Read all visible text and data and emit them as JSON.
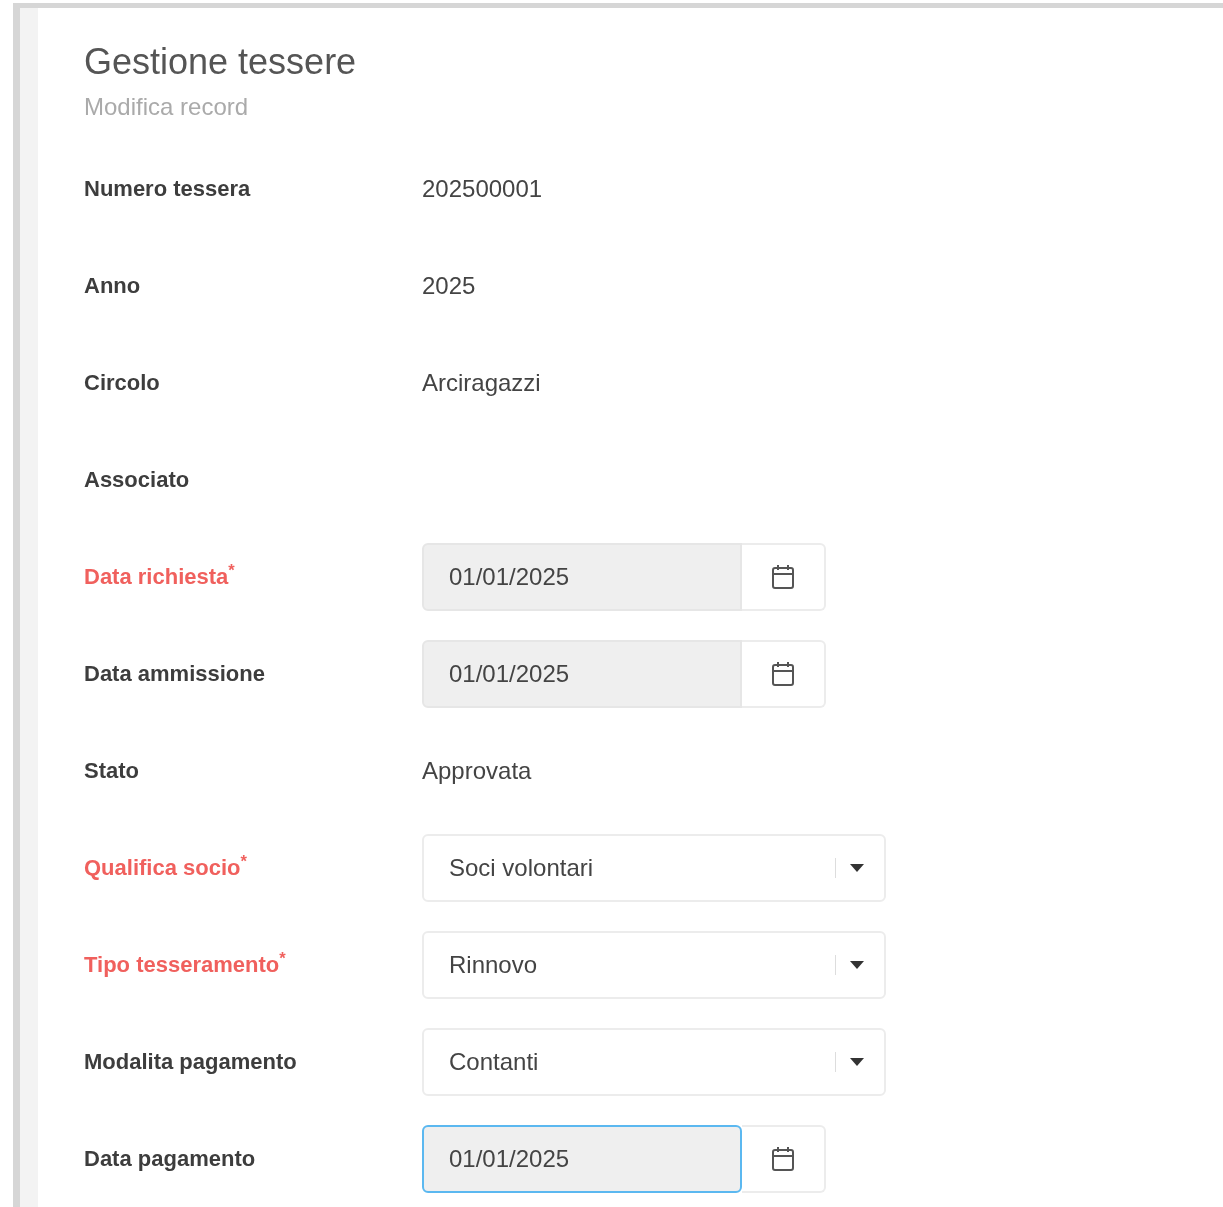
{
  "page": {
    "title": "Gestione tessere",
    "subtitle": "Modifica record"
  },
  "fields": [
    {
      "kind": "text",
      "label": "Numero tessera",
      "required": false,
      "value": "202500001"
    },
    {
      "kind": "text",
      "label": "Anno",
      "required": false,
      "value": "2025"
    },
    {
      "kind": "text",
      "label": "Circolo",
      "required": false,
      "value": "Arciragazzi"
    },
    {
      "kind": "empty",
      "label": "Associato",
      "required": false
    },
    {
      "kind": "date",
      "label": "Data richiesta$^{*}$",
      "required": true,
      "value": "01/01/2025",
      "focused": false
    },
    {
      "kind": "date",
      "label": "Data ammissione",
      "required": false,
      "value": "01/01/2025",
      "focused": false
    },
    {
      "kind": "text",
      "label": "Stato",
      "required": false,
      "value": "Approvata"
    },
    {
      "kind": "select",
      "label": "Qualifica socio$^{*}$",
      "required": true,
      "value": "Soci volontari"
    },
    {
      "kind": "select",
      "label": "Tipo tesseramento$^{*}$",
      "required": true,
      "value": "Rinnovo"
    },
    {
      "kind": "select",
      "label": "Modalita pagamento",
      "required": false,
      "value": "Contanti"
    },
    {
      "kind": "date",
      "label": "Data pagamento",
      "required": false,
      "value": "01/01/2025",
      "focused": true
    }
  ]
}
